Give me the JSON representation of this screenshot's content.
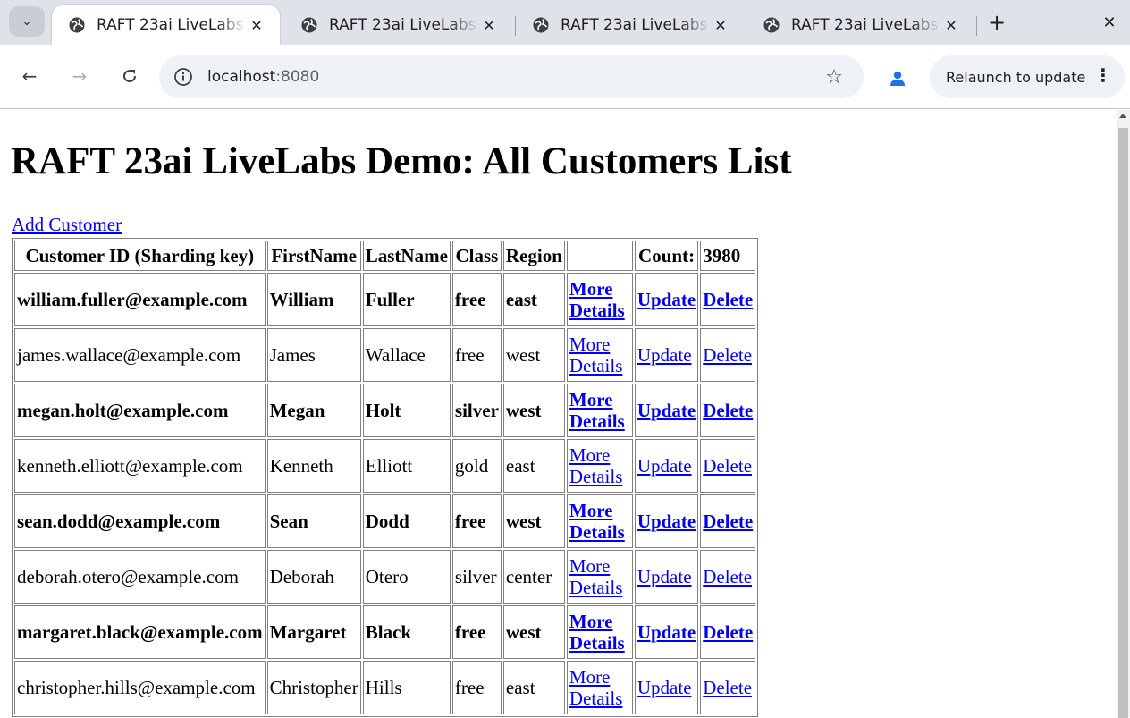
{
  "browser": {
    "tabs": [
      {
        "title": "RAFT 23ai LiveLabs Demo: All Customers List",
        "active": true
      },
      {
        "title": "RAFT 23ai LiveLabs Demo: All Customers List",
        "active": false
      },
      {
        "title": "RAFT 23ai LiveLabs Demo: All Customers List",
        "active": false
      },
      {
        "title": "RAFT 23ai LiveLabs Demo: All Customers List",
        "active": false
      }
    ],
    "url_host": "localhost",
    "url_port": ":8080",
    "relaunch_label": "Relaunch to update"
  },
  "page": {
    "title": "RAFT 23ai LiveLabs Demo: All Customers List",
    "add_link": "Add Customer",
    "table": {
      "headers": [
        "Customer ID (Sharding key)",
        "FirstName",
        "LastName",
        "Class",
        "Region",
        "",
        "Count:",
        "3980"
      ],
      "more_details_label": "More Details",
      "update_label": "Update",
      "delete_label": "Delete",
      "rows": [
        {
          "id": "william.fuller@example.com",
          "first": "William",
          "last": "Fuller",
          "cls": "free",
          "region": "east",
          "bold": true
        },
        {
          "id": "james.wallace@example.com",
          "first": "James",
          "last": "Wallace",
          "cls": "free",
          "region": "west",
          "bold": false
        },
        {
          "id": "megan.holt@example.com",
          "first": "Megan",
          "last": "Holt",
          "cls": "silver",
          "region": "west",
          "bold": true
        },
        {
          "id": "kenneth.elliott@example.com",
          "first": "Kenneth",
          "last": "Elliott",
          "cls": "gold",
          "region": "east",
          "bold": false
        },
        {
          "id": "sean.dodd@example.com",
          "first": "Sean",
          "last": "Dodd",
          "cls": "free",
          "region": "west",
          "bold": true
        },
        {
          "id": "deborah.otero@example.com",
          "first": "Deborah",
          "last": "Otero",
          "cls": "silver",
          "region": "center",
          "bold": false
        },
        {
          "id": "margaret.black@example.com",
          "first": "Margaret",
          "last": "Black",
          "cls": "free",
          "region": "west",
          "bold": true
        },
        {
          "id": "christopher.hills@example.com",
          "first": "Christopher",
          "last": "Hills",
          "cls": "free",
          "region": "east",
          "bold": false
        }
      ]
    }
  }
}
